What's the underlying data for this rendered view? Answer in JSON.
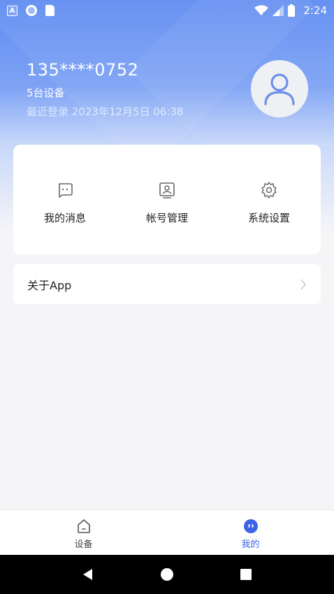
{
  "status_bar": {
    "time": "2:24",
    "left_icons": [
      "app-a-icon",
      "sync-circle-icon",
      "sd-card-icon"
    ],
    "right_icons": [
      "wifi-icon",
      "signal-icon",
      "battery-icon"
    ]
  },
  "profile": {
    "phone": "135****0752",
    "device_count": "5台设备",
    "last_login": "最近登录 2023年12月5日 06:38"
  },
  "menu": {
    "items": [
      {
        "label": "我的消息",
        "icon": "message-icon"
      },
      {
        "label": "帐号管理",
        "icon": "account-icon"
      },
      {
        "label": "系统设置",
        "icon": "settings-icon"
      }
    ]
  },
  "about": {
    "label": "关于App"
  },
  "tabs": [
    {
      "label": "设备",
      "icon": "home-icon",
      "active": false
    },
    {
      "label": "我的",
      "icon": "profile-face-icon",
      "active": true
    }
  ],
  "colors": {
    "accent": "#3d63e6",
    "hero_top": "#5f8cf2",
    "background": "#f5f5f7"
  }
}
